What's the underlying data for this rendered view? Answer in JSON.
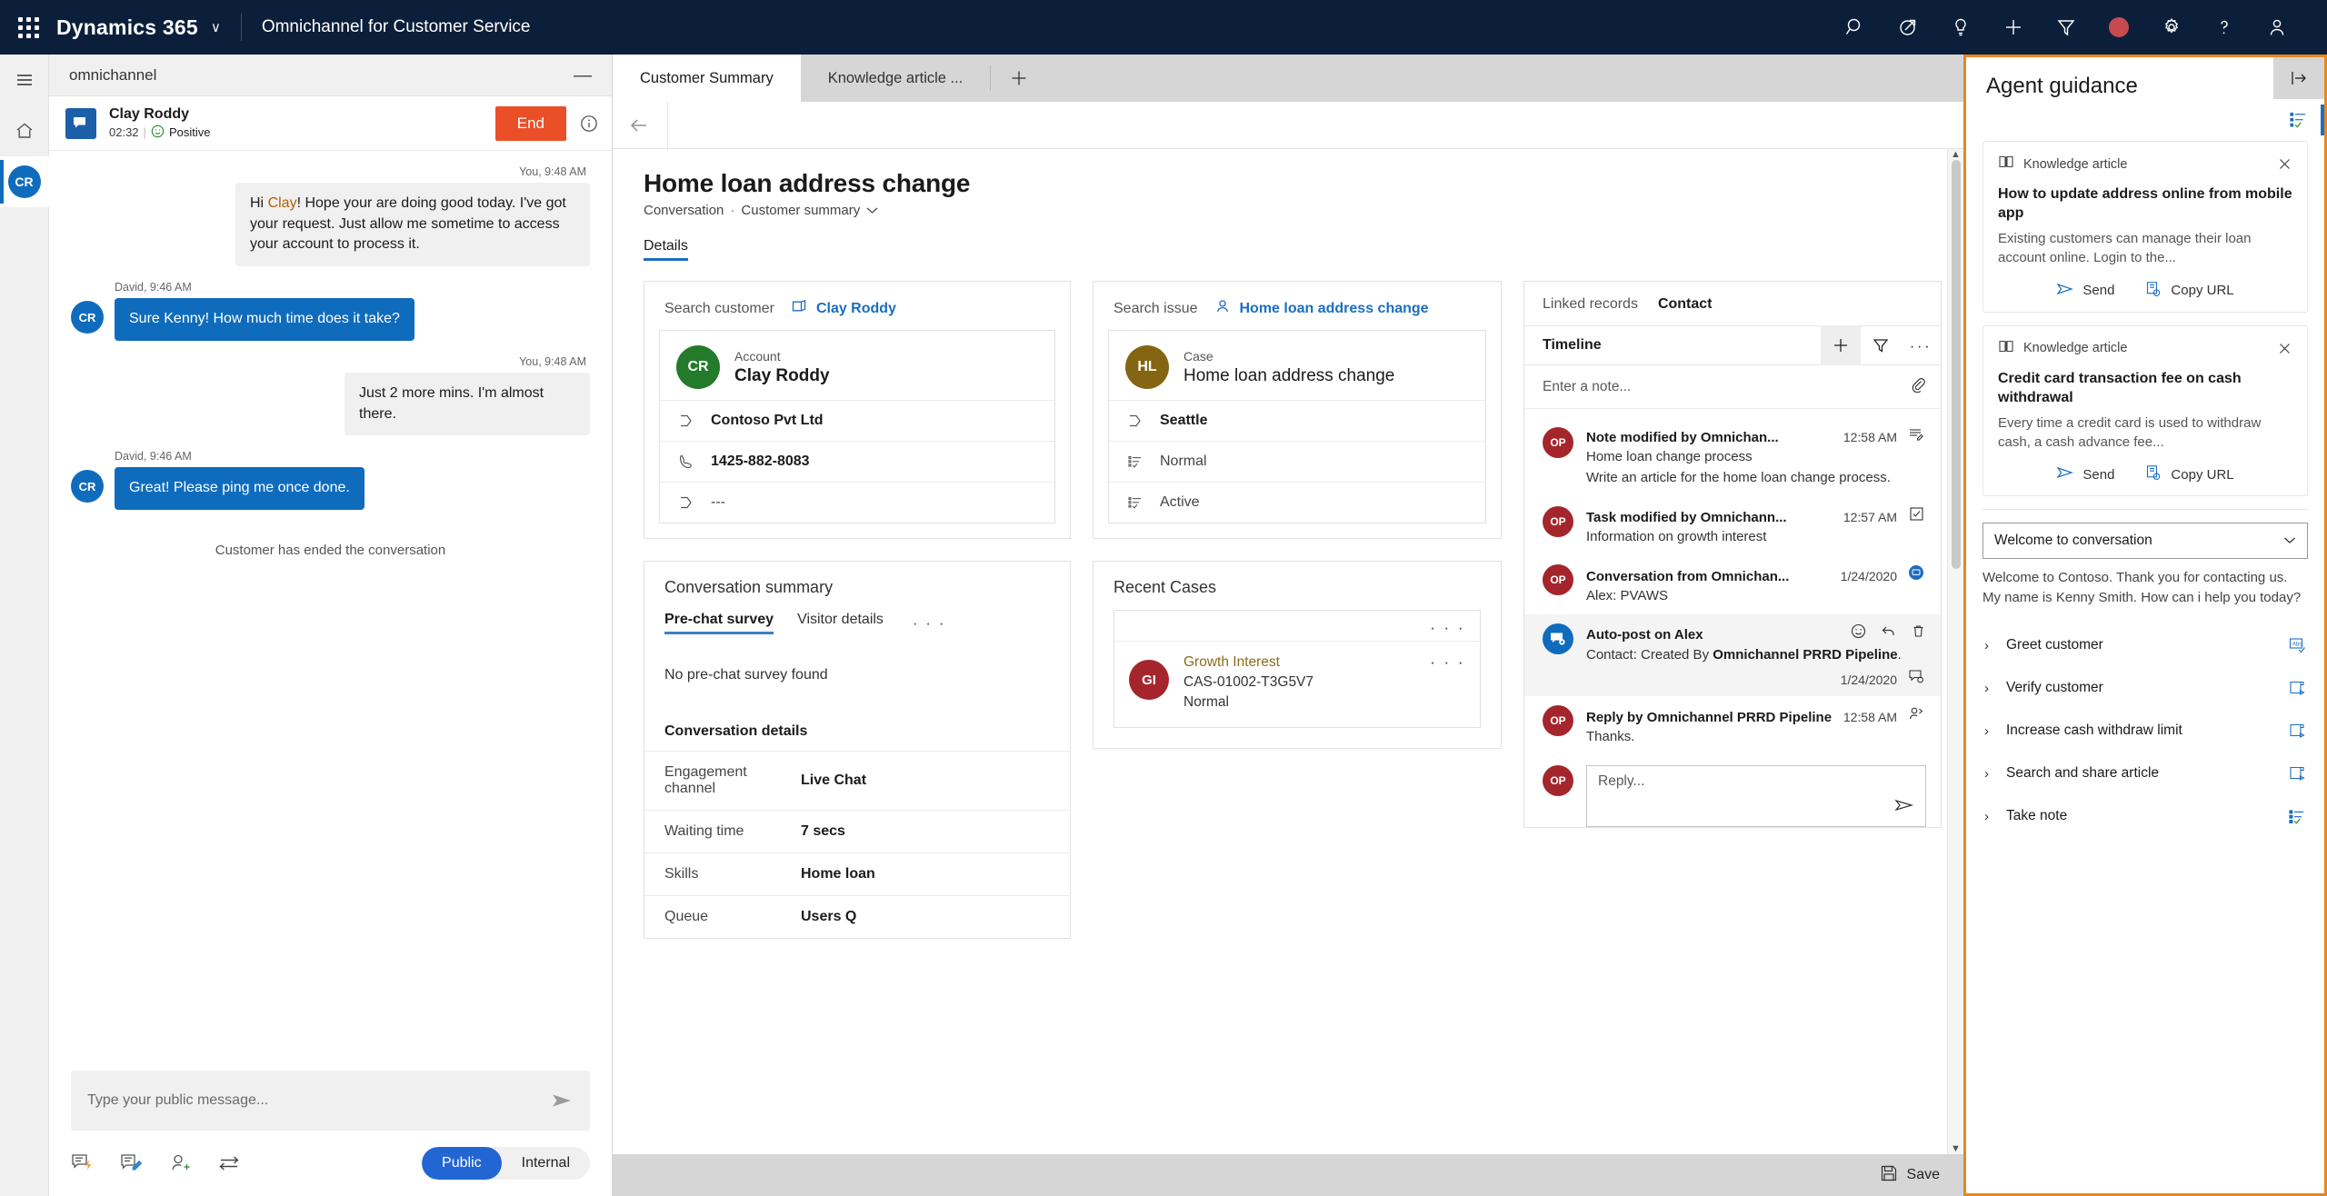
{
  "header": {
    "brand": "Dynamics 365",
    "brand_caret": "∨",
    "app_name": "Omnichannel for Customer Service",
    "icons": [
      "waffle-icon",
      "search-icon",
      "dashboard-arrow-icon",
      "lightbulb-icon",
      "plus-icon",
      "filter-icon",
      "presence-dot-icon",
      "gear-icon",
      "help-icon",
      "account-icon"
    ]
  },
  "rail": {
    "menu": "hamburger-menu-icon",
    "home": "home-icon",
    "session_initials": "CR"
  },
  "chat": {
    "window_title": "omnichannel",
    "minimize": "—",
    "customer_name": "Clay Roddy",
    "duration": "02:32",
    "sentiment": "Positive",
    "end_label": "End",
    "messages": [
      {
        "direction": "out",
        "stamp": "You, 9:48 AM",
        "text_pre": "Hi ",
        "text_hl": "Clay",
        "text_post": "! Hope your are doing good today. I've got your request. Just allow me sometime to access your account to process it."
      },
      {
        "direction": "in",
        "stamp": "David, 9:46 AM",
        "avatar": "CR",
        "text": "Sure Kenny! How much time does it take?"
      },
      {
        "direction": "out",
        "stamp": "You, 9:48 AM",
        "text_pre": "",
        "text_hl": "",
        "text_post": "Just 2 more mins. I'm almost there."
      },
      {
        "direction": "in",
        "stamp": "David, 9:46 AM",
        "avatar": "CR",
        "text": "Great! Please ping me once done."
      }
    ],
    "system_note": "Customer has ended the conversation",
    "compose_placeholder": "Type your public message...",
    "action_icons": [
      "quick-reply-icon",
      "note-icon",
      "add-participant-icon",
      "transfer-icon"
    ],
    "visibility": {
      "public": "Public",
      "internal": "Internal",
      "selected": "Public"
    }
  },
  "main": {
    "tabs": [
      {
        "label": "Customer Summary",
        "active": true
      },
      {
        "label": "Knowledge article ...",
        "active": false
      }
    ],
    "add_tab": "+",
    "back_icon": "back-arrow-icon",
    "record_title": "Home loan address change",
    "breadcrumb_entity": "Conversation",
    "breadcrumb_form": "Customer summary",
    "form_tabs": [
      {
        "label": "Details",
        "active": true
      }
    ],
    "customer_card": {
      "search_label": "Search customer",
      "link": "Clay Roddy",
      "link_icon": "open-record-icon",
      "entity_type": "Account",
      "initials": "CR",
      "avatar_color": "#237b2b",
      "name": "Clay Roddy",
      "rows": [
        {
          "icon": "field-icon",
          "value": "Contoso Pvt Ltd",
          "bold": true
        },
        {
          "icon": "phone-icon",
          "value": "1425-882-8083",
          "bold": true
        },
        {
          "icon": "field-icon",
          "value": "---",
          "bold": false
        }
      ]
    },
    "issue_card": {
      "search_label": "Search issue",
      "link": "Home loan address  change",
      "link_icon": "contact-icon",
      "entity_type": "Case",
      "initials": "HL",
      "avatar_color": "#846512",
      "name": "Home loan address change",
      "rows": [
        {
          "icon": "field-icon",
          "value": "Seattle",
          "bold": true
        },
        {
          "icon": "list-check-icon",
          "value": "Normal",
          "bold": false
        },
        {
          "icon": "list-check-icon",
          "value": "Active",
          "bold": false
        }
      ]
    },
    "conversation_summary": {
      "title": "Conversation summary",
      "tabs": [
        {
          "label": "Pre-chat survey",
          "active": true
        },
        {
          "label": "Visitor details",
          "active": false
        }
      ],
      "more": "· · ·",
      "empty": "No pre-chat survey found",
      "section": "Conversation details",
      "details": [
        {
          "key": "Engagement channel",
          "value": "Live Chat"
        },
        {
          "key": "Waiting time",
          "value": "7 secs"
        },
        {
          "key": "Skills",
          "value": "Home loan"
        },
        {
          "key": "Queue",
          "value": "Users Q"
        }
      ]
    },
    "recent_cases": {
      "title": "Recent Cases",
      "more": "· · ·",
      "items": [
        {
          "initials": "GI",
          "line1": "Growth Interest",
          "line2": "CAS-01002-T3G5V7",
          "line3": "Normal",
          "more": "· · ·"
        }
      ]
    },
    "timeline": {
      "tabs": [
        {
          "label": "Linked records",
          "active": false
        },
        {
          "label": "Contact",
          "active": true
        }
      ],
      "bar_label": "Timeline",
      "bar_icons": [
        "plus-icon",
        "filter-icon",
        "more-icon"
      ],
      "note_placeholder": "Enter a note...",
      "attach_icon": "paperclip-icon",
      "items": [
        {
          "avatar": "OP",
          "avatar_color": "red",
          "title": "Note modified by Omnichan...",
          "time": "12:58 AM",
          "icon": "note-icon",
          "line2": "Home loan change process",
          "line3": "Write an article for the home loan change process.",
          "highlight": false
        },
        {
          "avatar": "OP",
          "avatar_color": "red",
          "title": "Task modified by Omnichann...",
          "time": "12:57 AM",
          "icon": "task-check-icon",
          "line2": "Information on growth interest",
          "line3": "",
          "highlight": false
        },
        {
          "avatar": "OP",
          "avatar_color": "red",
          "title": "Conversation from Omnichan...",
          "time": "1/24/2020",
          "icon": "conversation-badge-icon",
          "line2": "Alex: PVAWS",
          "line3": "",
          "highlight": false
        },
        {
          "avatar": "post",
          "avatar_color": "blue",
          "title": "Auto-post on Alex",
          "time": "1/24/2020",
          "icon": "post-icon",
          "line2_pre": "Contact: Created By ",
          "line2_b": "Omnichannel PRRD Pipeline",
          "line2_post": ".",
          "actions": [
            "emoji-icon",
            "reply-icon",
            "delete-icon"
          ],
          "highlight": true
        },
        {
          "avatar": "OP",
          "avatar_color": "red",
          "title": "Reply by Omnichannel PRRD Pipeline",
          "time": "12:58 AM",
          "icon": "reply-user-icon",
          "line2": "Thanks.",
          "line3": "",
          "highlight": false
        }
      ],
      "reply_avatar": "OP",
      "reply_placeholder": "Reply...",
      "reply_send_icon": "send-icon"
    },
    "status_bar": {
      "save_label": "Save",
      "save_icon": "save-icon"
    }
  },
  "guidance": {
    "title": "Agent guidance",
    "expand_icon": "expand-panel-icon",
    "rail_icon": "agent-script-icon",
    "cards": [
      {
        "kind": "Knowledge article",
        "kind_icon": "book-icon",
        "close_icon": "close-icon",
        "title": "How to update address online from mobile app",
        "desc": "Existing customers can manage their loan account online. Login to the...",
        "send_label": "Send",
        "copy_label": "Copy URL"
      },
      {
        "kind": "Knowledge article",
        "kind_icon": "book-icon",
        "close_icon": "close-icon",
        "title": "Credit card transaction fee on cash withdrawal",
        "desc": "Every time a credit card is used to withdraw cash, a cash advance fee...",
        "send_label": "Send",
        "copy_label": "Copy URL"
      }
    ],
    "script_select": "Welcome to conversation",
    "script_caret": "∨",
    "script_text": "Welcome to Contoso. Thank you for contacting us. My name is Kenny Smith. How can i help you today?",
    "steps": [
      {
        "label": "Greet customer",
        "icon": "text-macro-icon"
      },
      {
        "label": "Verify customer",
        "icon": "script-run-icon"
      },
      {
        "label": "Increase cash withdraw limit",
        "icon": "script-run-icon"
      },
      {
        "label": "Search and share article",
        "icon": "script-run-icon"
      },
      {
        "label": "Take note",
        "icon": "list-check-icon"
      }
    ],
    "chevron": "›",
    "accent_color": "#e8871e"
  }
}
